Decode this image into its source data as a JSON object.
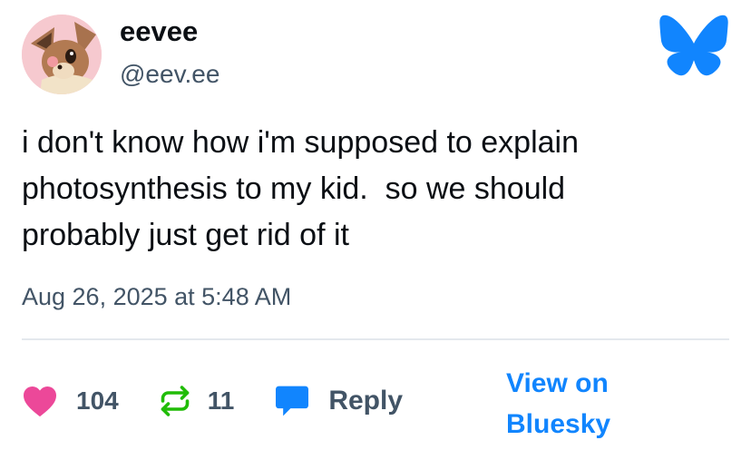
{
  "author": {
    "display_name": "eevee",
    "handle": "@eev.ee",
    "avatar_icon": "eevee-avatar"
  },
  "brand": {
    "logo_icon": "bluesky-butterfly-icon",
    "color": "#1185fe"
  },
  "post": {
    "text": "i don't know how i'm supposed to explain\nphotosynthesis to my kid.  so we should\nprobably just get rid of it",
    "timestamp": "Aug 26, 2025 at 5:48 AM"
  },
  "actions": {
    "likes_count": "104",
    "like_icon": "heart-icon",
    "like_color": "#ec4899",
    "reposts_count": "11",
    "repost_icon": "repost-icon",
    "repost_color": "#20bc07",
    "reply_label": "Reply",
    "reply_icon": "speech-bubble-icon",
    "view_link": "View on Bluesky"
  }
}
